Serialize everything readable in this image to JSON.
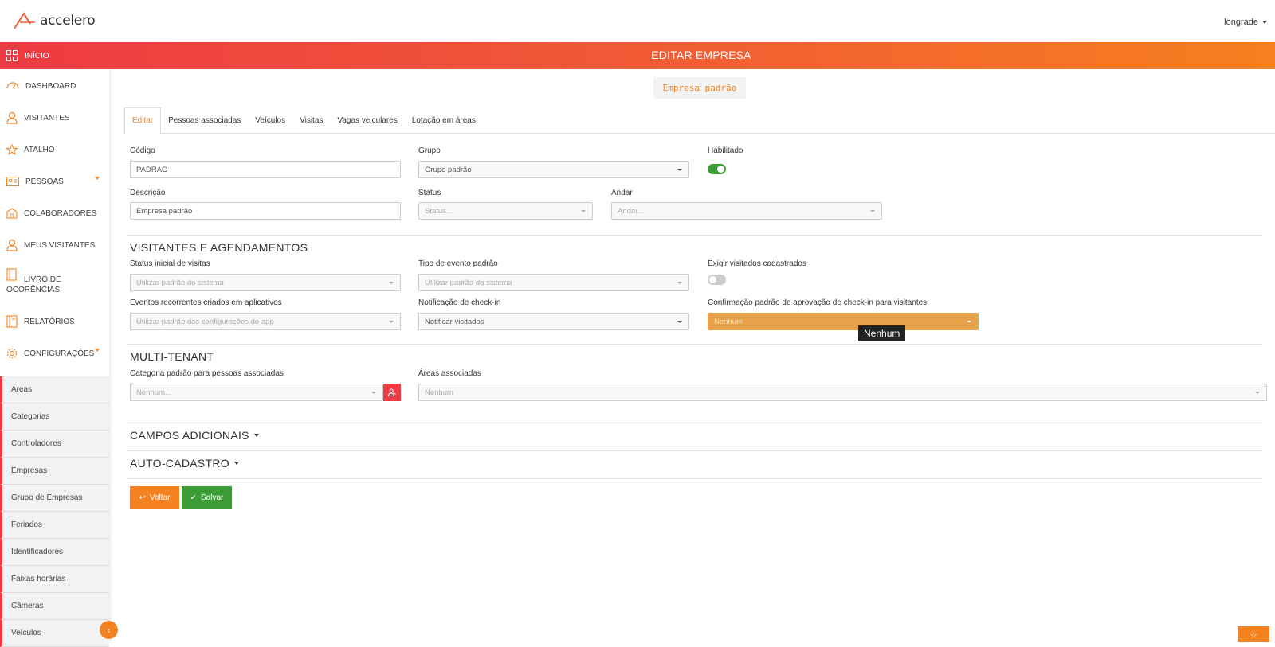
{
  "app": {
    "logo_text": "accelero",
    "user": "longrade",
    "page_title": "EDITAR EMPRESA",
    "home_label": "INÍCIO"
  },
  "colors": {
    "accent": "#f58220",
    "header_start": "#ee3a42",
    "header_end": "#f7801f",
    "success": "#3b9b35",
    "warning_select": "#e8a24a"
  },
  "sidebar": {
    "items": [
      {
        "label": "DASHBOARD",
        "icon": "dashboard-gauge-icon"
      },
      {
        "label": "VISITANTES",
        "icon": "user-icon"
      },
      {
        "label": "ATALHO",
        "icon": "star-icon"
      },
      {
        "label": "PESSOAS",
        "icon": "id-card-icon"
      },
      {
        "label": "COLABORADORES",
        "icon": "building-icon"
      },
      {
        "label": "MEUS VISITANTES",
        "icon": "user-icon"
      },
      {
        "label": "LIVRO DE OCORÊNCIAS",
        "icon": "book-icon"
      },
      {
        "label": "RELATÓRIOS",
        "icon": "report-icon"
      },
      {
        "label": "CONFIGURAÇÕES",
        "icon": "gear-icon"
      }
    ],
    "sub_items": [
      "Áreas",
      "Categorias",
      "Controladores",
      "Empresas",
      "Grupo de Empresas",
      "Feriados",
      "Identificadores",
      "Faixas horárias",
      "Câmeras",
      "Veículos"
    ]
  },
  "company_chip": "Empresa padrão",
  "tabs": [
    "Editar",
    "Pessoas associadas",
    "Veículos",
    "Visitas",
    "Vagas veiculares",
    "Lotação em áreas"
  ],
  "form": {
    "codigo": {
      "label": "Código",
      "value": "PADRAO"
    },
    "grupo": {
      "label": "Grupo",
      "value": "Grupo padrão"
    },
    "habilitado": {
      "label": "Habilitado",
      "on": true
    },
    "descricao": {
      "label": "Descrição",
      "value": "Empresa padrão"
    },
    "status": {
      "label": "Status",
      "placeholder": "Status..."
    },
    "andar": {
      "label": "Andar",
      "placeholder": "Andar..."
    }
  },
  "visitantes": {
    "title": "VISITANTES E AGENDAMENTOS",
    "status_inicial": {
      "label": "Status inicial de visitas",
      "value": "Utilizar padrão do sistema"
    },
    "tipo_evento": {
      "label": "Tipo de evento padrão",
      "value": "Utilizar padrão do sistema"
    },
    "exigir": {
      "label": "Exigir visitados cadastrados",
      "on": false
    },
    "eventos_recorrentes": {
      "label": "Eventos recorrentes criados em aplicativos",
      "value": "Utilizar padrão das configurações do app"
    },
    "notificacao": {
      "label": "Notificação de check-in",
      "value": "Notificar visitados"
    },
    "confirmacao": {
      "label": "Confirmação padrão de aprovação de check-in para visitantes",
      "value": "Nenhum"
    },
    "tooltip": "Nenhum"
  },
  "multi_tenant": {
    "title": "MULTI-TENANT",
    "categoria": {
      "label": "Categoria padrão para pessoas associadas",
      "placeholder": "Nenhum..."
    },
    "areas": {
      "label": "Áreas associadas",
      "value": "Nenhum"
    }
  },
  "campos_adicionais": "CAMPOS ADICIONAIS",
  "auto_cadastro": "AUTO-CADASTRO",
  "buttons": {
    "back": "Voltar",
    "save": "Salvar"
  }
}
